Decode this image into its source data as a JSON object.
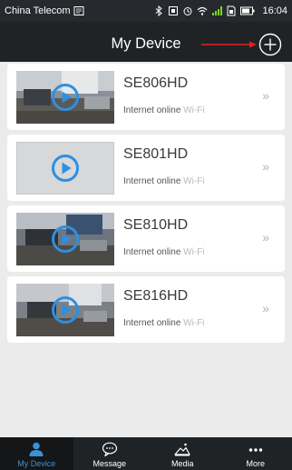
{
  "status_bar": {
    "carrier": "China Telecom",
    "time": "16:04"
  },
  "header": {
    "title": "My Device",
    "add_icon": "plus-circle-icon"
  },
  "devices": [
    {
      "name": "SE806HD",
      "status_prefix": "Internet online ",
      "status_wifi": "Wi-Fi",
      "preview": "office-scene",
      "chevron": "»"
    },
    {
      "name": "SE801HD",
      "status_prefix": "Internet online ",
      "status_wifi": "Wi-Fi",
      "preview": "empty",
      "chevron": "»"
    },
    {
      "name": "SE810HD",
      "status_prefix": "Internet online ",
      "status_wifi": "Wi-Fi",
      "preview": "office-scene",
      "chevron": "»"
    },
    {
      "name": "SE816HD",
      "status_prefix": "Internet online ",
      "status_wifi": "Wi-Fi",
      "preview": "office-scene",
      "chevron": "»"
    }
  ],
  "tabs": [
    {
      "label": "My Device",
      "icon": "person-icon",
      "active": true
    },
    {
      "label": "Message",
      "icon": "chat-bubble-icon",
      "active": false
    },
    {
      "label": "Media",
      "icon": "mountain-image-icon",
      "active": false
    },
    {
      "label": "More",
      "icon": "ellipsis-icon",
      "active": false
    }
  ],
  "colors": {
    "accent": "#3a91d6",
    "play_button": "#2f8fe0",
    "annotation_arrow": "#e02020",
    "bar_background": "#1f2326",
    "list_background": "#ebebeb"
  }
}
